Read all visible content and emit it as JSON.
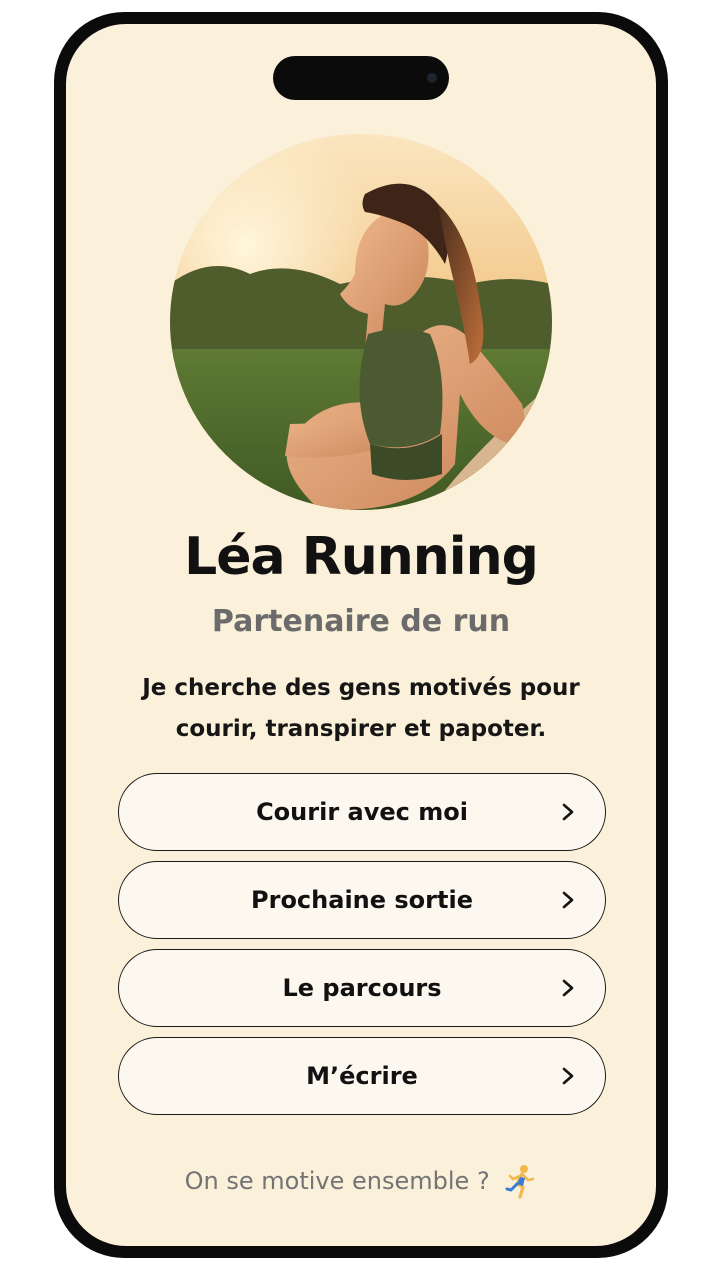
{
  "profile": {
    "name": "Léa Running",
    "tagline": "Partenaire de run",
    "bio": "Je cherche des gens motivés pour courir, transpirer et papoter.",
    "avatar_icon": "runner-photo"
  },
  "links": [
    {
      "label": "Courir avec moi",
      "icon": "chevron-right-icon"
    },
    {
      "label": "Prochaine sortie",
      "icon": "chevron-right-icon"
    },
    {
      "label": "Le parcours",
      "icon": "chevron-right-icon"
    },
    {
      "label": "M’écrire",
      "icon": "chevron-right-icon"
    }
  ],
  "footer": {
    "text": "On se motive ensemble ?",
    "icon": "runner-emoji"
  },
  "colors": {
    "background": "#fbf0d9",
    "frame": "#0b0b0b",
    "button_fill": "#fcf8ef",
    "text_primary": "#111111",
    "text_muted": "#6b6b6b"
  }
}
